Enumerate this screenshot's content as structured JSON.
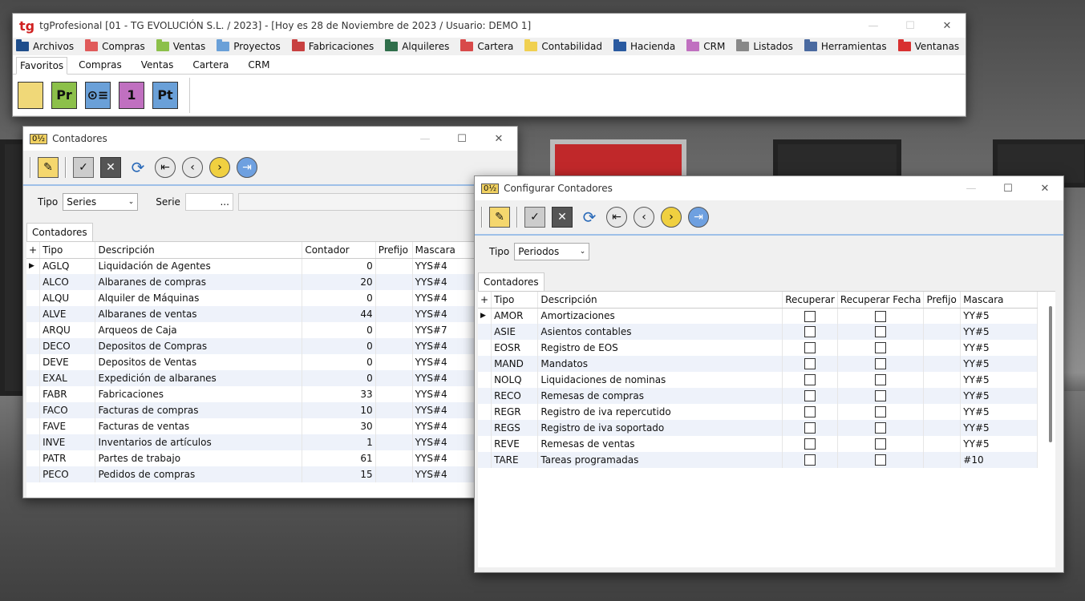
{
  "main": {
    "logo": "tg",
    "title": "tgProfesional [01 - TG EVOLUCIÓN S.L. / 2023] - [Hoy es 28 de Noviembre de 2023 / Usuario: DEMO 1]",
    "menu": [
      {
        "label": "Archivos",
        "color": "#1f4e8c"
      },
      {
        "label": "Compras",
        "color": "#e05a5a"
      },
      {
        "label": "Ventas",
        "color": "#8cc04a"
      },
      {
        "label": "Proyectos",
        "color": "#6aa0d8"
      },
      {
        "label": "Fabricaciones",
        "color": "#c84040"
      },
      {
        "label": "Alquileres",
        "color": "#2f6e4a"
      },
      {
        "label": "Cartera",
        "color": "#d84a4a"
      },
      {
        "label": "Contabilidad",
        "color": "#f0d050"
      },
      {
        "label": "Hacienda",
        "color": "#2a5aa0"
      },
      {
        "label": "CRM",
        "color": "#c070c0"
      },
      {
        "label": "Listados",
        "color": "#888888"
      },
      {
        "label": "Herramientas",
        "color": "#4a6aa0"
      },
      {
        "label": "Ventanas",
        "color": "#d83030"
      }
    ],
    "tabs": [
      "Favoritos",
      "Compras",
      "Ventas",
      "Cartera",
      "CRM"
    ],
    "ribbon": [
      {
        "icon": "archive-box-icon",
        "text": "",
        "color": "#f0d878"
      },
      {
        "icon": "pr-icon",
        "text": "Pr",
        "color": "#8cc04a"
      },
      {
        "icon": "presentation-icon",
        "text": "⊙≡",
        "color": "#6aa0d8"
      },
      {
        "icon": "calendar-icon",
        "text": "1",
        "color": "#c070c0"
      },
      {
        "icon": "pt-icon",
        "text": "Pt",
        "color": "#6aa0d8"
      }
    ]
  },
  "w1": {
    "title": "Contadores",
    "tipo_label": "Tipo",
    "tipo_value": "Series",
    "serie_label": "Serie",
    "serie_value": "...",
    "tab": "Contadores",
    "columns": [
      "+",
      "Tipo",
      "Descripción",
      "Contador",
      "Prefijo",
      "Mascara"
    ],
    "rows": [
      [
        "AGLQ",
        "Liquidación de Agentes",
        "0",
        "",
        "YYS#4"
      ],
      [
        "ALCO",
        "Albaranes de compras",
        "20",
        "",
        "YYS#4"
      ],
      [
        "ALQU",
        "Alquiler de Máquinas",
        "0",
        "",
        "YYS#4"
      ],
      [
        "ALVE",
        "Albaranes de ventas",
        "44",
        "",
        "YYS#4"
      ],
      [
        "ARQU",
        "Arqueos de Caja",
        "0",
        "",
        "YYS#7"
      ],
      [
        "DECO",
        "Depositos de Compras",
        "0",
        "",
        "YYS#4"
      ],
      [
        "DEVE",
        "Depositos de Ventas",
        "0",
        "",
        "YYS#4"
      ],
      [
        "EXAL",
        "Expedición de albaranes",
        "0",
        "",
        "YYS#4"
      ],
      [
        "FABR",
        "Fabricaciones",
        "33",
        "",
        "YYS#4"
      ],
      [
        "FACO",
        "Facturas de compras",
        "10",
        "",
        "YYS#4"
      ],
      [
        "FAVE",
        "Facturas de ventas",
        "30",
        "",
        "YYS#4"
      ],
      [
        "INVE",
        "Inventarios de artículos",
        "1",
        "",
        "YYS#4"
      ],
      [
        "PATR",
        "Partes de trabajo",
        "61",
        "",
        "YYS#4"
      ],
      [
        "PECO",
        "Pedidos de compras",
        "15",
        "",
        "YYS#4"
      ]
    ]
  },
  "w2": {
    "title": "Configurar Contadores",
    "tipo_label": "Tipo",
    "tipo_value": "Periodos",
    "tab": "Contadores",
    "columns": [
      "+",
      "Tipo",
      "Descripción",
      "Recuperar",
      "Recuperar Fecha",
      "Prefijo",
      "Mascara"
    ],
    "rows": [
      [
        "AMOR",
        "Amortizaciones",
        "",
        "",
        "",
        "YY#5"
      ],
      [
        "ASIE",
        "Asientos contables",
        "",
        "",
        "",
        "YY#5"
      ],
      [
        "EOSR",
        "Registro de EOS",
        "",
        "",
        "",
        "YY#5"
      ],
      [
        "MAND",
        "Mandatos",
        "",
        "",
        "",
        "YY#5"
      ],
      [
        "NOLQ",
        "Liquidaciones de nominas",
        "",
        "",
        "",
        "YY#5"
      ],
      [
        "RECO",
        "Remesas de compras",
        "",
        "",
        "",
        "YY#5"
      ],
      [
        "REGR",
        "Registro de iva repercutido",
        "",
        "",
        "",
        "YY#5"
      ],
      [
        "REGS",
        "Registro de iva soportado",
        "",
        "",
        "",
        "YY#5"
      ],
      [
        "REVE",
        "Remesas de ventas",
        "",
        "",
        "",
        "YY#5"
      ],
      [
        "TARE",
        "Tareas programadas",
        "",
        "",
        "",
        "#10"
      ]
    ]
  }
}
